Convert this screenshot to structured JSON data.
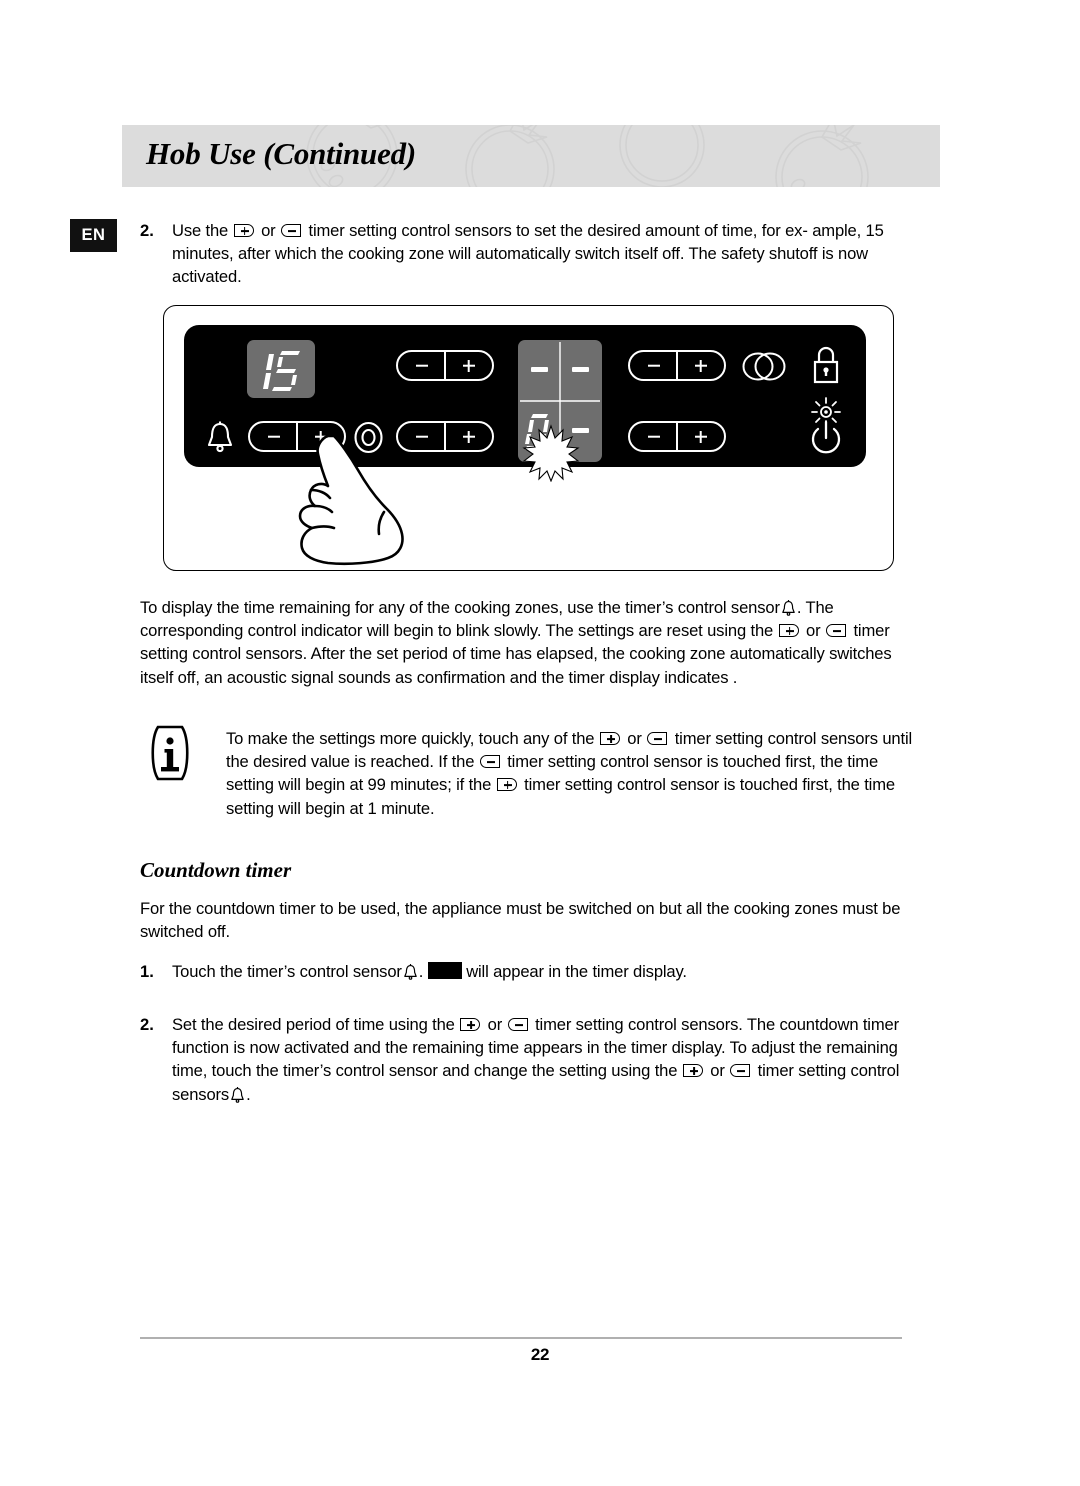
{
  "document": {
    "language_badge": "EN",
    "page_title": "Hob Use (Continued)",
    "page_number": "22"
  },
  "step_2_top": {
    "marker": "2.",
    "line1_a": "Use the",
    "line1_b": "or",
    "line1_c": "timer setting control sensors to set the desired amount of time, for ex-",
    "line2": "ample, 15 minutes, after which the cooking zone will automatically switch itself off.",
    "line3": "The safety shutoff is now activated."
  },
  "hob_illustration": {
    "timer_display_value": "15",
    "center_display": {
      "top_left": "-",
      "top_right": "-",
      "bottom_left": "0",
      "bottom_right": "-"
    },
    "icons": {
      "bell": "bell-icon",
      "single_zone": "single-zone-icon",
      "dual_zone": "dual-zone-icon",
      "lock": "lock-icon",
      "heat_indicator": "heat-indicator-icon",
      "power": "power-icon",
      "blink_marker": "blink-starburst-icon",
      "hand": "hand-pointing-icon"
    },
    "sensor_labels": {
      "minus": "-",
      "plus": "+"
    }
  },
  "body_paragraph": {
    "line1_a": "To display the time remaining for any of the cooking zones, use the timer’s control sensor",
    "line1_b": ".",
    "line2": "The corresponding control indicator will begin to blink slowly.",
    "line3_a": "The settings are reset using the",
    "line3_b": "or",
    "line3_c": "timer setting control sensors. After the set period of",
    "line4": "time has elapsed, the cooking zone automatically switches itself off, an acoustic signal sounds",
    "line5": "as confirmation and the timer display indicates ."
  },
  "note_box": {
    "icon": "info-icon",
    "line1_a": "To make the settings more quickly, touch any of the",
    "line1_b": "or",
    "line1_c": "timer setting control",
    "line2": "sensors until the desired value is reached.",
    "line3_a": "If the",
    "line3_b": "timer setting control sensor is touched first, the time setting will begin at 99",
    "line4_a": "minutes; if the",
    "line4_b": "timer setting control sensor is touched first, the time setting will",
    "line5": "begin at 1 minute."
  },
  "section": {
    "heading": "Countdown timer",
    "intro_line1": "For the countdown timer to be used, the appliance must be switched on but all the cooking",
    "intro_line2": "zones must be switched off."
  },
  "step_1": {
    "marker": "1.",
    "line1_a": "Touch the timer’s control sensor",
    "line1_b": ".",
    "line2": "will appear in the timer display."
  },
  "step_2_bottom": {
    "marker": "2.",
    "line1_a": "Set the desired period of time using the",
    "line1_b": "or",
    "line1_c": "timer setting control sensors.",
    "line2": "The countdown timer function is now activated and the remaining time appears in the timer",
    "line3": "display.",
    "line4": "To adjust the remaining time, touch the timer’s control sensor and change the setting using",
    "line5_a": "the",
    "line5_b": "or",
    "line5_c": "timer setting control sensors",
    "line5_d": "."
  },
  "colors": {
    "header_band": "#dcdcdc",
    "panel_black": "#000000",
    "display_gray": "#6e6e6e",
    "badge_black": "#111111",
    "rule_gray": "#b0b0b0"
  }
}
